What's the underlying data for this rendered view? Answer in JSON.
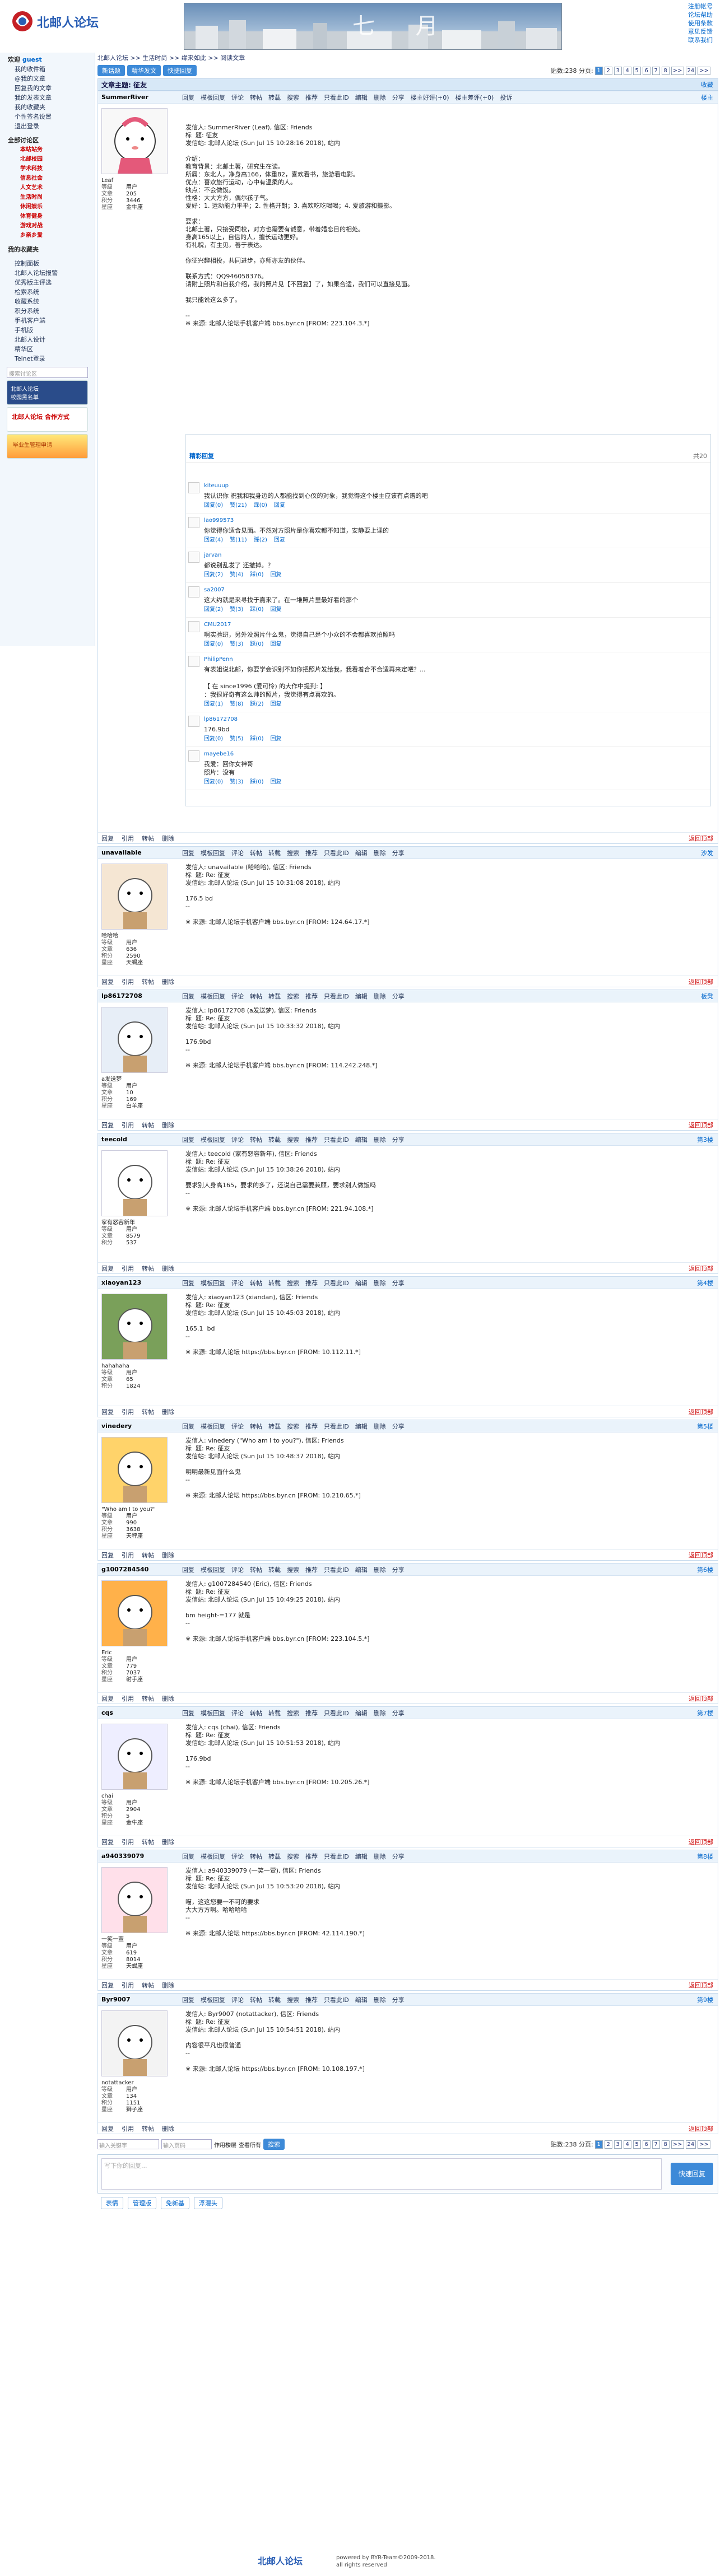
{
  "site": {
    "name": "北邮人论坛",
    "banner_text": "七 月"
  },
  "top_links": [
    "注册帐号",
    "论坛帮助",
    "使用条款",
    "意见反馈",
    "联系我们"
  ],
  "sidebar": {
    "user": {
      "title": "欢迎",
      "name": "guest",
      "items": [
        "我的收件箱",
        "@我的文章",
        "回复我的文章",
        "我的发表文章",
        "我的收藏夹",
        "个性签名设置",
        "退出登录"
      ]
    },
    "sec1": {
      "title": "全部讨论区",
      "subs": [
        "本站站务",
        "北邮校园",
        "学术科技",
        "信息社会",
        "人文艺术",
        "生活时尚",
        "休闲娱乐",
        "体育健身",
        "游戏对战",
        "乡亲乡爱"
      ]
    },
    "my_fav": "我的收藏夹",
    "menu": [
      "控制面板",
      "北邮人论坛报警",
      "优秀版主评选",
      "检索系统",
      "收藏系统",
      "积分系统",
      "手机客户端",
      "手机版",
      "北邮人设计",
      "精华区",
      "Telnet登录"
    ],
    "search_placeholder": "搜索讨论区",
    "badge1": "北邮人论坛",
    "badge2": "校园黑名单",
    "badge3": "北邮人论坛 合作方式",
    "badge4": "毕业生管理申请"
  },
  "crumbs": "北邮人论坛 >> 生活时尚 >> 缘来如此 >> 阅读文章",
  "buttons": [
    "新话题",
    "精华发文",
    "快捷回复"
  ],
  "pager": {
    "label": "贴数:238  分页:",
    "pages": [
      "1",
      "2",
      "3",
      "4",
      "5",
      "6",
      "7",
      "8",
      ">>",
      "24",
      ">>"
    ],
    "cur": "1"
  },
  "topic": {
    "label": "文章主题: 征友",
    "right": "收藏"
  },
  "post_actions": [
    "回复",
    "模板回复",
    "评论",
    "转帖",
    "转载",
    "搜索",
    "推荐",
    "只看此ID",
    "编辑",
    "删除",
    "分享"
  ],
  "first": {
    "user": "SummerRiver",
    "floor": "楼主",
    "head_extra": [
      "楼主好评(+0)",
      "楼主差评(+0)",
      "投诉"
    ],
    "nick": "Leaf",
    "info": [
      [
        "等级",
        "用户"
      ],
      [
        "文章",
        "205"
      ],
      [
        "积分",
        "3446"
      ],
      [
        "星座",
        "金牛座"
      ]
    ],
    "body": "发信人: SummerRiver (Leaf), 信区: Friends\n标  题: 征友\n发信站: 北邮人论坛 (Sun Jul 15 10:28:16 2018), 站内\n\n介绍：\n教育背景：北邮土著，研究生在读。\n所属：东北人，净身高166，体重82，喜欢看书，旅游看电影。\n优点：喜欢旅行运动，心中有温柔的人。\n缺点：不会做饭。\n性格：大大方方，偶尔孩子气。\n爱好：1. 运动能力平平；2. 性格开朗；3. 喜欢吃吃喝喝；4. 爱旅游和摄影。\n\n要求：\n北邮土著，只接受同校，对方也需要有诚意，带着婚恋目的相处。\n身高165以上，自信的人，擅长运动更好。\n有礼貌，有主见，善于表达。\n\n你征兴趣相投，共同进步，亦师亦友的伙伴。\n\n联系方式：QQ946058376。\n请附上照片和自我介绍，我的照片见【不回复】了，如果合适，我们可以直接见面。\n\n我只能说这么多了。\n\n--\n※ 来源: 北邮人论坛手机客户端 bbs.byr.cn [FROM: 223.104.3.*]"
  },
  "comments": {
    "title": "精彩回复",
    "count": "共20",
    "items": [
      {
        "name": "kiteuuup",
        "text": "我认识你 祝我和我身边的人都能找到心仪的对象，我觉得这个楼主应该有点谱的吧",
        "acts": [
          "回复(0)",
          "赞(21)",
          "踩(0)",
          "回复"
        ]
      },
      {
        "name": "lao999573",
        "text": "你觉得你适合见面。不然对方照片是你喜欢都不知道，安静要上课的",
        "acts": [
          "回复(4)",
          "赞(11)",
          "踩(2)",
          "回复"
        ]
      },
      {
        "name": "jarvan",
        "text": "都说别乱发了 还撤掉。？",
        "acts": [
          "回复(2)",
          "赞(4)",
          "踩(0)",
          "回复"
        ]
      },
      {
        "name": "sa2007",
        "text": "这大约就是来寻找于嘉来了。在一堆照片里最好看的那个",
        "acts": [
          "回复(2)",
          "赞(3)",
          "踩(0)",
          "回复"
        ]
      },
      {
        "name": "CMU2017",
        "text": "啊实验班，另外没照片什么鬼，觉得自己是个小众的不会都喜欢拍照吗",
        "acts": [
          "回复(0)",
          "赞(3)",
          "踩(0)",
          "回复"
        ]
      },
      {
        "name": "PhilipPenn",
        "text": "有表姐说北邮，你要学会识别不如你把照片发给我，我看着合不合适再来定吧？...\n\n【 在 since1996 (爱可怜) 的大作中提到: 】\n：我很好奇有这么帅的照片，我觉得有点喜欢的。",
        "acts": [
          "回复(1)",
          "赞(8)",
          "踩(2)",
          "回复"
        ]
      },
      {
        "name": "lp86172708",
        "text": "176.9bd",
        "acts": [
          "回复(0)",
          "赞(5)",
          "踩(0)",
          "回复"
        ]
      },
      {
        "name": "mayebe16",
        "text": "我爱：回你女神哥\n照片：没有",
        "acts": [
          "回复(0)",
          "赞(3)",
          "踩(0)",
          "回复"
        ]
      }
    ]
  },
  "replies": [
    {
      "user": "unavailable",
      "floor": "沙发",
      "nick": "哈哈哈",
      "info": [
        [
          "等级",
          "用户"
        ],
        [
          "文章",
          "636"
        ],
        [
          "积分",
          "2590"
        ],
        [
          "星座",
          "天蝎座"
        ]
      ],
      "body": "发信人: unavailable (哈哈哈), 信区: Friends\n标  题: Re: 征友\n发信站: 北邮人论坛 (Sun Jul 15 10:31:08 2018), 站内\n\n176.5 bd\n--\n\n※ 来源: 北邮人论坛手机客户端 bbs.byr.cn [FROM: 124.64.17.*]",
      "cls": "src3"
    },
    {
      "user": "lp86172708",
      "floor": "板凳",
      "nick": "a发送梦",
      "info": [
        [
          "等级",
          "用户"
        ],
        [
          "文章",
          "10"
        ],
        [
          "积分",
          "169"
        ],
        [
          "星座",
          "白羊座"
        ]
      ],
      "body": "发信人: lp86172708 (a发送梦), 信区: Friends\n标  题: Re: 征友\n发信站: 北邮人论坛 (Sun Jul 15 10:33:32 2018), 站内\n\n176.9bd\n--\n\n※ 来源: 北邮人论坛手机客户端 bbs.byr.cn [FROM: 114.242.248.*]",
      "cls": "src3"
    },
    {
      "user": "teecold",
      "floor": "第3楼",
      "nick": "家有怒容新年",
      "info": [
        [
          "等级",
          "用户"
        ],
        [
          "文章",
          "8579"
        ],
        [
          "积分",
          "537"
        ]
      ],
      "body": "发信人: teecold (家有怒容新年), 信区: Friends\n标  题: Re: 征友\n发信站: 北邮人论坛 (Sun Jul 15 10:38:26 2018), 站内\n\n要求别人身高165，要求的多了，还说自己需要兼顾，要求别人做饭吗\n--\n\n※ 来源: 北邮人论坛手机客户端 bbs.byr.cn [FROM: 221.94.108.*]",
      "cls": "src"
    },
    {
      "user": "xiaoyan123",
      "floor": "第4楼",
      "nick": "hahahaha",
      "info": [
        [
          "等级",
          "用户"
        ],
        [
          "文章",
          "65"
        ],
        [
          "积分",
          "1824"
        ]
      ],
      "body": "发信人: xiaoyan123 (xiandan), 信区: Friends\n标  题: Re: 征友\n发信站: 北邮人论坛 (Sun Jul 15 10:45:03 2018), 站内\n\n165.1  bd\n--\n\n※ 来源: 北邮人论坛 https://bbs.byr.cn [FROM: 10.112.11.*]",
      "cls": "src2"
    },
    {
      "user": "vinedery",
      "floor": "第5楼",
      "nick": "\"Who am I to you?\"",
      "info": [
        [
          "等级",
          "用户"
        ],
        [
          "文章",
          "990"
        ],
        [
          "积分",
          "3638"
        ],
        [
          "星座",
          "天秤座"
        ]
      ],
      "body": "发信人: vinedery (\"Who am I to you?\"), 信区: Friends\n标  题: Re: 征友\n发信站: 北邮人论坛 (Sun Jul 15 10:48:37 2018), 站内\n\n明明最新见面什么鬼\n--\n\n※ 来源: 北邮人论坛 https://bbs.byr.cn [FROM: 10.210.65.*]",
      "cls": "src3"
    },
    {
      "user": "g1007284540",
      "floor": "第6楼",
      "nick": "Eric",
      "info": [
        [
          "等级",
          "用户"
        ],
        [
          "文章",
          "779"
        ],
        [
          "积分",
          "7037"
        ],
        [
          "星座",
          "射手座"
        ]
      ],
      "body": "发信人: g1007284540 (Eric), 信区: Friends\n标  题: Re: 征友\n发信站: 北邮人论坛 (Sun Jul 15 10:49:25 2018), 站内\n\nbm height-=177 就是\n--\n\n※ 来源: 北邮人论坛手机客户端 bbs.byr.cn [FROM: 223.104.5.*]",
      "cls": "src2"
    },
    {
      "user": "cqs",
      "floor": "第7楼",
      "nick": "chai",
      "info": [
        [
          "等级",
          "用户"
        ],
        [
          "文章",
          "2904"
        ],
        [
          "积分",
          "5"
        ],
        [
          "星座",
          "金牛座"
        ]
      ],
      "body": "发信人: cqs (chai), 信区: Friends\n标  题: Re: 征友\n发信站: 北邮人论坛 (Sun Jul 15 10:51:53 2018), 站内\n\n176.9bd\n--\n\n※ 来源: 北邮人论坛手机客户端 bbs.byr.cn [FROM: 10.205.26.*]",
      "cls": "src3"
    },
    {
      "user": "a940339079",
      "floor": "第8楼",
      "nick": "一笑一萱",
      "info": [
        [
          "等级",
          "用户"
        ],
        [
          "文章",
          "619"
        ],
        [
          "积分",
          "8014"
        ],
        [
          "星座",
          "天蝎座"
        ]
      ],
      "body": "发信人: a940339079 (一笑一萱), 信区: Friends\n标  题: Re: 征友\n发信站: 北邮人论坛 (Sun Jul 15 10:53:20 2018), 站内\n\n喵，这这您要一不可的要求\n大大方方啊。哈哈哈哈\n--\n\n※ 来源: 北邮人论坛 https://bbs.byr.cn [FROM: 42.114.190.*]",
      "cls": "src2"
    },
    {
      "user": "Byr9007",
      "floor": "第9楼",
      "nick": "notattacker",
      "info": [
        [
          "等级",
          "用户"
        ],
        [
          "文章",
          "134"
        ],
        [
          "积分",
          "1151"
        ],
        [
          "星座",
          "狮子座"
        ]
      ],
      "body": "发信人: Byr9007 (notattacker), 信区: Friends\n标  题: Re: 征友\n发信站: 北邮人论坛 (Sun Jul 15 10:54:51 2018), 站内\n\n内容很平凡也很普通\n--\n\n※ 来源: 北邮人论坛 https://bbs.byr.cn [FROM: 10.108.197.*]",
      "cls": "src"
    }
  ],
  "reply_foot": [
    "回复",
    "引用",
    "转帖",
    "删除"
  ],
  "reply_head_right": "返回顶部",
  "bottom": {
    "search_placeholder": "输入关键字",
    "jump_placeholder": "输入页码",
    "check1": "作用楼层",
    "check2": "查看所有",
    "go": "搜索",
    "reply_placeholder": "写下你的回复...",
    "submit": "快速回复",
    "tabs": [
      "表情",
      "管理版",
      "免新基",
      "浮漫头"
    ]
  },
  "footer": {
    "copy": "powered by BYR-Team©2009-2018.",
    "rights": "all rights reserved"
  }
}
